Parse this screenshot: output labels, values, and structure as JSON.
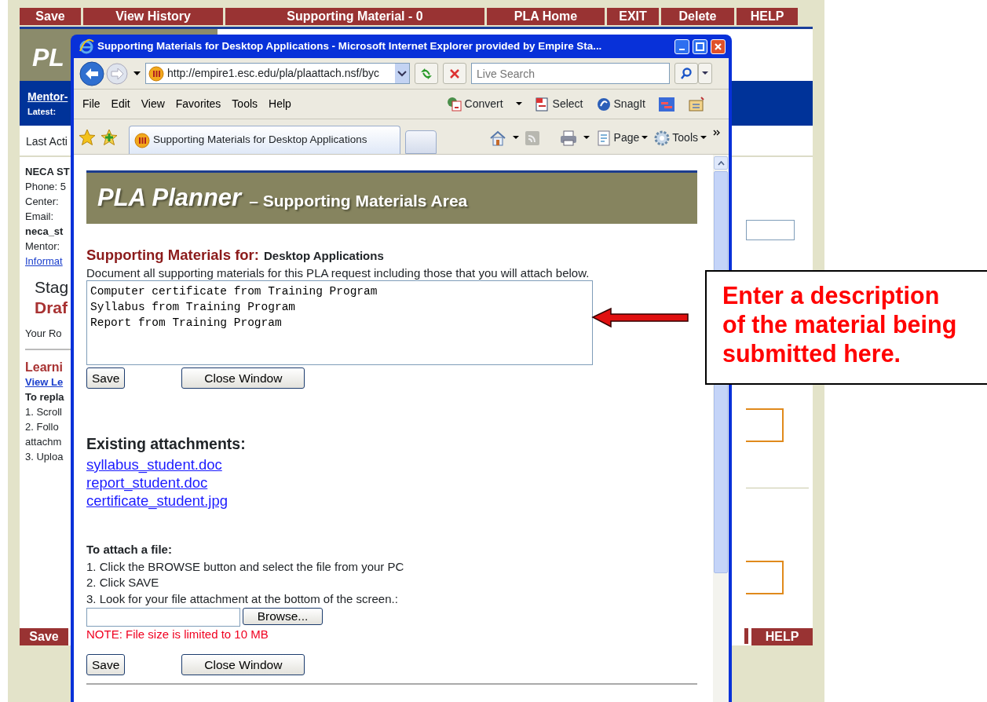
{
  "background_page": {
    "menu": [
      "Save",
      "View History",
      "Supporting Material - 0",
      "PLA Home",
      "EXIT",
      "Delete",
      "HELP"
    ],
    "banner_text": "PL",
    "mentor_link": "Mentor-",
    "latest_label": "Latest:",
    "last_activity": "Last Acti",
    "sidebar": [
      {
        "kind": "bold",
        "text": "NECA ST"
      },
      {
        "kind": "plain",
        "text": "Phone: 5"
      },
      {
        "kind": "plain",
        "text": "Center:"
      },
      {
        "kind": "plain",
        "text": "Email:"
      },
      {
        "kind": "bold",
        "text": "neca_st"
      },
      {
        "kind": "plain",
        "text": "Mentor:"
      },
      {
        "kind": "link",
        "text": "Informat"
      },
      {
        "kind": "stage",
        "text": "Stag"
      },
      {
        "kind": "status",
        "text": "Draf"
      },
      {
        "kind": "role",
        "text": "Your Ro"
      },
      {
        "kind": "heading",
        "text": "Learni"
      },
      {
        "kind": "link_bold",
        "text": "View Le"
      },
      {
        "kind": "bold",
        "text": "To repla"
      },
      {
        "kind": "plain",
        "text": "1. Scroll"
      },
      {
        "kind": "plain",
        "text": "2. Follo"
      },
      {
        "kind": "plain",
        "text": "attachm"
      },
      {
        "kind": "plain",
        "text": "3. Uploa"
      }
    ],
    "bottom_menu": [
      "Save",
      "HELP"
    ]
  },
  "browser": {
    "title": "Supporting Materials for Desktop Applications - Microsoft Internet Explorer provided by Empire Sta...",
    "address": "http://empire1.esc.edu/pla/plaattach.nsf/byc",
    "search": {
      "placeholder": "Live Search"
    },
    "menu": [
      "File",
      "Edit",
      "View",
      "Favorites",
      "Tools",
      "Help"
    ],
    "commands": [
      "Convert",
      "Select",
      "SnagIt"
    ],
    "tab": "Supporting Materials for Desktop Applications",
    "toolbar": [
      "Page",
      "Tools"
    ]
  },
  "content": {
    "header_title": "PLA Planner",
    "header_subtitle": "– Supporting Materials Area",
    "heading_label": "Supporting Materials for:",
    "heading_subject": "Desktop Applications",
    "instructions": "Document all supporting materials for this PLA request including those that you will attach below.",
    "description": "Computer certificate from Training Program\nSyllabus from Training Program\nReport from Training Program",
    "buttons": [
      "Save",
      "Close Window"
    ],
    "attachments_heading": "Existing attachments:",
    "attachments": [
      "syllabus_student.doc",
      "report_student.doc",
      "certificate_student.jpg"
    ],
    "attach_heading": "To attach a file:",
    "attach_steps": [
      "1. Click the BROWSE button and select the file from your PC",
      "2. Click SAVE",
      "3. Look for your file attachment at the bottom of the screen.:"
    ],
    "browse_button": "Browse...",
    "note": "NOTE: File size is limited to 10 MB",
    "bottom_buttons": [
      "Save",
      "Close Window"
    ]
  },
  "callout": {
    "text": "Enter a description of the material being submitted here."
  }
}
